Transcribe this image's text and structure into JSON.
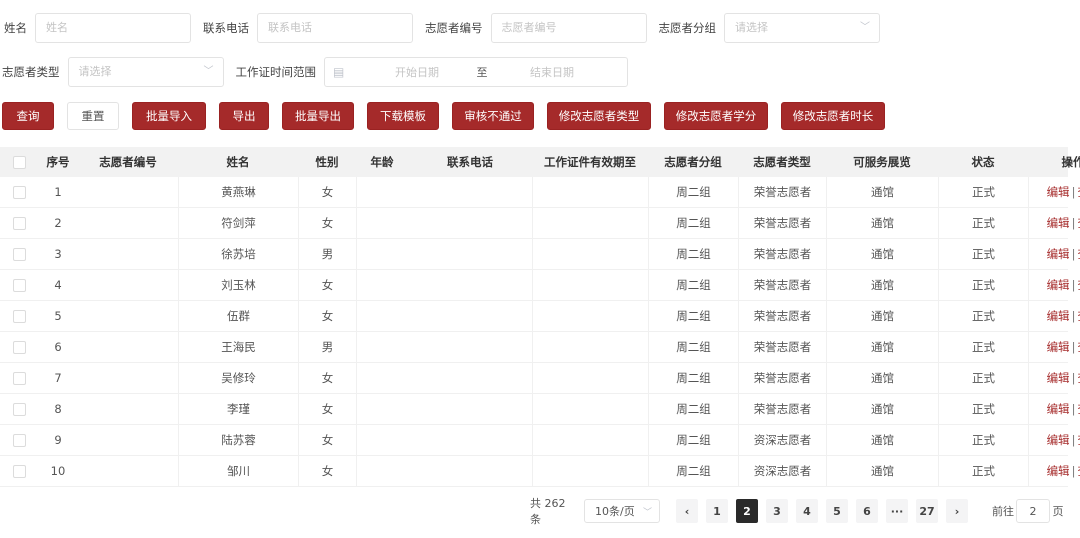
{
  "filters": {
    "name_label": "姓名",
    "name_placeholder": "姓名",
    "phone_label": "联系电话",
    "phone_placeholder": "联系电话",
    "vid_label": "志愿者编号",
    "vid_placeholder": "志愿者编号",
    "group_label": "志愿者分组",
    "group_placeholder": "请选择",
    "type_label": "志愿者类型",
    "type_placeholder": "请选择",
    "range_label": "工作证时间范围",
    "range_start": "开始日期",
    "range_sep": "至",
    "range_end": "结束日期"
  },
  "buttons": {
    "query": "查询",
    "reset": "重置",
    "batch_import": "批量导入",
    "export": "导出",
    "batch_export": "批量导出",
    "download_template": "下载模板",
    "reject": "审核不通过",
    "edit_type": "修改志愿者类型",
    "edit_credit": "修改志愿者学分",
    "edit_hours": "修改志愿者时长"
  },
  "table": {
    "headers": {
      "no": "序号",
      "vid": "志愿者编号",
      "name": "姓名",
      "sex": "性别",
      "age": "年龄",
      "phone": "联系电话",
      "cert": "工作证件有效期至",
      "group": "志愿者分组",
      "type": "志愿者类型",
      "venue": "可服务展览",
      "status": "状态",
      "op": "操作"
    },
    "edit_label": "编辑",
    "op_sep": "|",
    "view_label": "查看",
    "rows": [
      {
        "no": "1",
        "name": "黄燕琳",
        "sex": "女",
        "group": "周二组",
        "type": "荣誉志愿者",
        "venue": "通馆",
        "status": "正式"
      },
      {
        "no": "2",
        "name": "符剑萍",
        "sex": "女",
        "group": "周二组",
        "type": "荣誉志愿者",
        "venue": "通馆",
        "status": "正式"
      },
      {
        "no": "3",
        "name": "徐苏培",
        "sex": "男",
        "group": "周二组",
        "type": "荣誉志愿者",
        "venue": "通馆",
        "status": "正式"
      },
      {
        "no": "4",
        "name": "刘玉林",
        "sex": "女",
        "group": "周二组",
        "type": "荣誉志愿者",
        "venue": "通馆",
        "status": "正式"
      },
      {
        "no": "5",
        "name": "伍群",
        "sex": "女",
        "group": "周二组",
        "type": "荣誉志愿者",
        "venue": "通馆",
        "status": "正式"
      },
      {
        "no": "6",
        "name": "王海民",
        "sex": "男",
        "group": "周二组",
        "type": "荣誉志愿者",
        "venue": "通馆",
        "status": "正式"
      },
      {
        "no": "7",
        "name": "吴修玲",
        "sex": "女",
        "group": "周二组",
        "type": "荣誉志愿者",
        "venue": "通馆",
        "status": "正式"
      },
      {
        "no": "8",
        "name": "李瑾",
        "sex": "女",
        "group": "周二组",
        "type": "荣誉志愿者",
        "venue": "通馆",
        "status": "正式"
      },
      {
        "no": "9",
        "name": "陆苏蓉",
        "sex": "女",
        "group": "周二组",
        "type": "资深志愿者",
        "venue": "通馆",
        "status": "正式"
      },
      {
        "no": "10",
        "name": "邹川",
        "sex": "女",
        "group": "周二组",
        "type": "资深志愿者",
        "venue": "通馆",
        "status": "正式"
      }
    ]
  },
  "pagination": {
    "total": "共 262 条",
    "page_size": "10条/页",
    "prev": "‹",
    "pages": [
      "1",
      "2",
      "3",
      "4",
      "5",
      "6",
      "···",
      "27"
    ],
    "current": "2",
    "next": "›",
    "goto_label": "前往",
    "goto_value": "2",
    "goto_suffix": "页"
  },
  "colors": {
    "accent": "#a52a2a",
    "header_bg": "#f2f2f2",
    "active_page": "#2a2a2a"
  }
}
